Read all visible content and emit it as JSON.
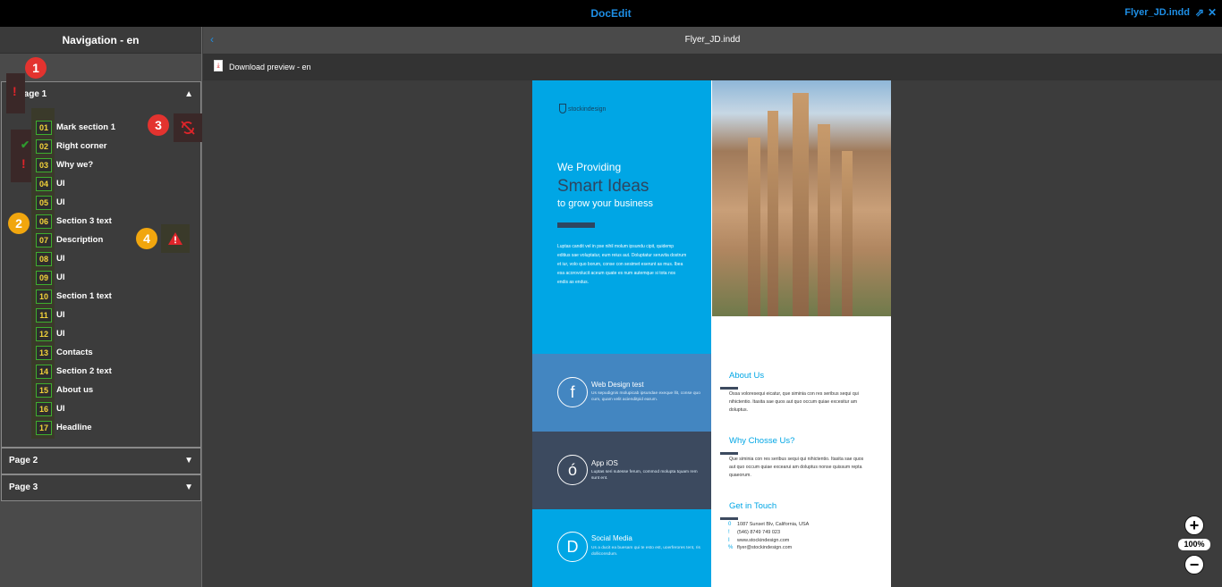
{
  "topbar": {
    "app_title": "DocEdit",
    "file_link": "Flyer_JD.indd"
  },
  "sidebar": {
    "header": "Navigation - en",
    "pages": [
      {
        "label": "Page 1",
        "expanded": true
      },
      {
        "label": "Page 2",
        "expanded": false
      },
      {
        "label": "Page 3",
        "expanded": false
      }
    ],
    "items": [
      {
        "num": "01",
        "label": "Mark section 1"
      },
      {
        "num": "02",
        "label": "Right corner"
      },
      {
        "num": "03",
        "label": "Why we?"
      },
      {
        "num": "04",
        "label": "UI"
      },
      {
        "num": "05",
        "label": "UI"
      },
      {
        "num": "06",
        "label": "Section 3 text"
      },
      {
        "num": "07",
        "label": "Description"
      },
      {
        "num": "08",
        "label": "UI"
      },
      {
        "num": "09",
        "label": "UI"
      },
      {
        "num": "10",
        "label": "Section 1 text"
      },
      {
        "num": "11",
        "label": "UI"
      },
      {
        "num": "12",
        "label": "UI"
      },
      {
        "num": "13",
        "label": "Contacts"
      },
      {
        "num": "14",
        "label": "Section 2 text"
      },
      {
        "num": "15",
        "label": "About us"
      },
      {
        "num": "16",
        "label": "UI"
      },
      {
        "num": "17",
        "label": "Headline"
      }
    ],
    "badges": [
      "1",
      "2",
      "3",
      "4"
    ]
  },
  "main": {
    "file_title": "Flyer_JD.indd",
    "download_label": "Download preview - en",
    "zoom_level": "100%"
  },
  "flyer": {
    "logo_text": "stockindesign",
    "we_providing": "We Providing",
    "smart_ideas": "Smart Ideas",
    "grow": "to grow your business",
    "lorem": "Luptas candit vel in pse nihil molum ipsundu cipit, quidemp editius sae voluptatur, eum reius aut. Doluptatur seruvita dostrum et iur, volo quo borum, conse con sesimet eserunt as mus. Ibea esa acorovolucit aceum quate es num autemque si tota nos endis as endus.",
    "blocks": [
      {
        "icon": "f",
        "title": "Web Design test",
        "text": "Us sepudignis molupicab ipsundae exeque llit, conse quo cum, quam velit acienditpid earum."
      },
      {
        "icon": "ó",
        "title": "App iOS",
        "text": "Luptas seri sutesse ferum, commod molupta tquam rem sunt ent."
      },
      {
        "icon": "D",
        "title": "Social Media",
        "text": "Us a ducit ea buesam qui te esto est, uoerferores tent, ris dolliconsdum."
      }
    ],
    "about_title": "About Us",
    "about_text": "Ossa voloresequi eicatur, que siminia con res seribus sequi qui nihictentio. Itasita sae quos aut quo occum quiae excesitur am doluptus.",
    "why_title": "Why Chosse Us?",
    "why_text": "Que siminia con res seribus sequi qui nihictentio. Itasita sae quos aut quo occum quiae excearui am doluptus nonse quissum repta quaeorum.",
    "touch_title": "Get in Touch",
    "contacts": [
      {
        "icon": "0",
        "text": "1087 Sunset Blv, California, USA"
      },
      {
        "icon": "!",
        "text": "(546) 8749 749 023"
      },
      {
        "icon": "I",
        "text": "www.stockindesign.com"
      },
      {
        "icon": "%",
        "text": "flyer@stockindesign.com"
      }
    ]
  },
  "colors": {
    "accent": "#1e8fe6",
    "item_border": "#3eae2e",
    "item_number": "#f3d23a",
    "error": "#e0242a",
    "ok": "#2f9a2f",
    "flyer_blue": "#00a6e5",
    "flyer_dark": "#3c4a5f"
  }
}
